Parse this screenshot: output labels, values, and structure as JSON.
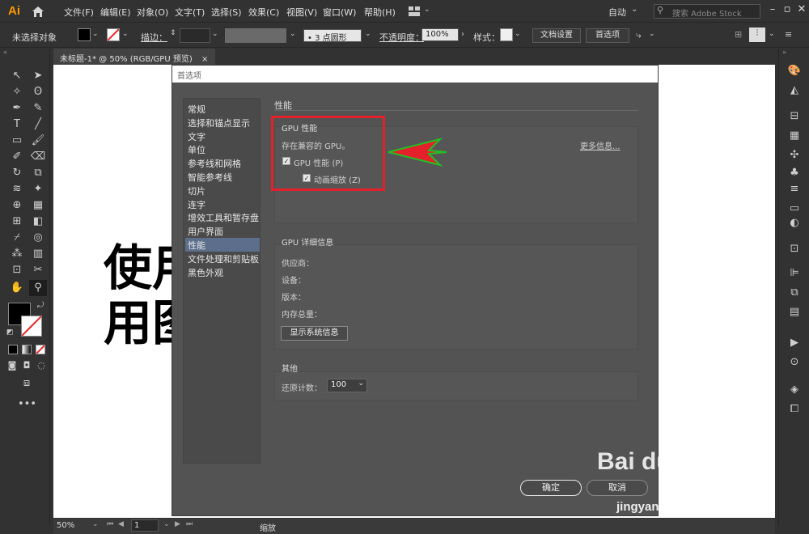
{
  "app": {
    "logo": "Ai"
  },
  "menubar": {
    "items": [
      "文件(F)",
      "编辑(E)",
      "对象(O)",
      "文字(T)",
      "选择(S)",
      "效果(C)",
      "视图(V)",
      "窗口(W)",
      "帮助(H)"
    ],
    "workspace": "自动",
    "search_placeholder": "搜索 Adobe Stock"
  },
  "controlbar": {
    "selection": "未选择对象",
    "stroke_label": "描边：",
    "brush": "3 点圆形",
    "opacity_label": "不透明度：",
    "opacity_value": "100%",
    "style_label": "样式：",
    "doc_settings": "文档设置",
    "preferences": "首选项"
  },
  "document": {
    "tab_title": "未标题-1* @ 50% (RGB/GPU 预览)",
    "canvas_line1": "使用",
    "canvas_line2": "用图"
  },
  "status": {
    "zoom": "50%",
    "page": "1",
    "label": "缩放"
  },
  "dialog": {
    "title": "首选项",
    "categories": [
      "常规",
      "选择和锚点显示",
      "文字",
      "单位",
      "参考线和网格",
      "智能参考线",
      "切片",
      "连字",
      "增效工具和暂存盘",
      "用户界面",
      "性能",
      "文件处理和剪贴板",
      "黑色外观"
    ],
    "selected_index": 10,
    "section_title": "性能",
    "gpu": {
      "group_label": "GPU 性能",
      "status": "存在兼容的 GPU。",
      "more_info": "更多信息...",
      "gpu_perf": "GPU 性能 (P)",
      "animated_zoom": "动画缩放 (Z)"
    },
    "gpu_details": {
      "group_label": "GPU 详细信息",
      "vendor": "供应商：",
      "device": "设备：",
      "version": "版本：",
      "memory": "内存总量：",
      "show_info": "显示系统信息"
    },
    "other": {
      "group_label": "其他",
      "undo_label": "还原计数：",
      "undo_value": "100"
    },
    "ok": "确定",
    "cancel": "取消"
  },
  "watermark": {
    "brand": "Bai du 经验",
    "url": "jingyan.baidu.com"
  },
  "colors": {
    "accent_sel": "#5c6e8c",
    "highlight_box": "#e4202a",
    "arrow": "#e4202a",
    "arrow_outline": "#22c022"
  }
}
